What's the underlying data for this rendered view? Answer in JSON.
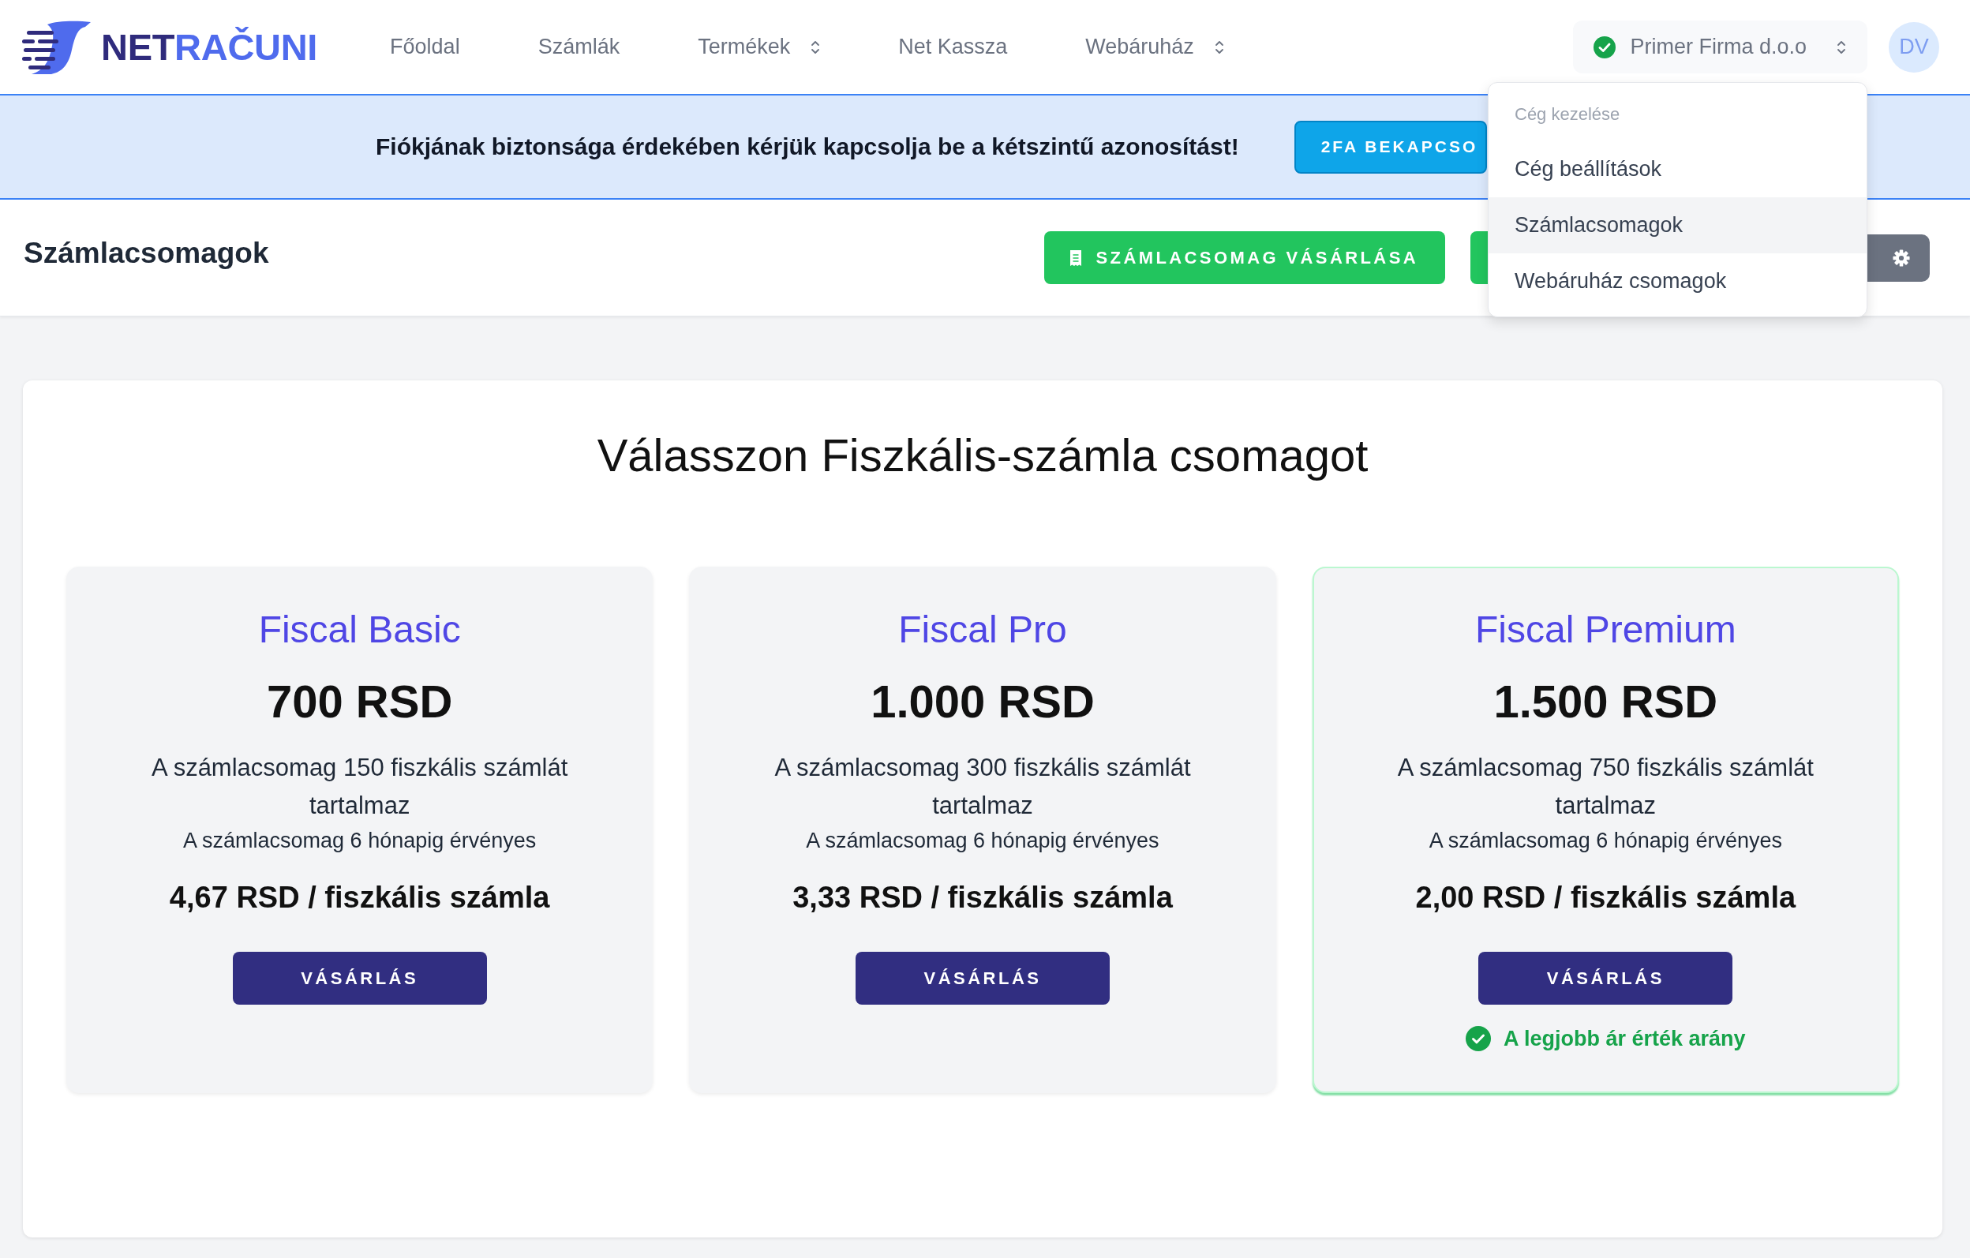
{
  "header": {
    "logo": {
      "wordmark_start": "NET",
      "wordmark_end": "RAČUNI"
    },
    "nav": [
      {
        "label": "Főoldal",
        "has_submenu": false
      },
      {
        "label": "Számlák",
        "has_submenu": false
      },
      {
        "label": "Termékek",
        "has_submenu": true
      },
      {
        "label": "Net Kassza",
        "has_submenu": false
      },
      {
        "label": "Webáruház",
        "has_submenu": true
      }
    ],
    "company_selector": {
      "name": "Primer Firma d.o.o",
      "verified": true,
      "menu": {
        "heading": "Cég kezelése",
        "items": [
          {
            "label": "Cég beállítások",
            "selected": false
          },
          {
            "label": "Számlacsomagok",
            "selected": true
          },
          {
            "label": "Webáruház csomagok",
            "selected": false
          }
        ]
      }
    },
    "avatar": {
      "initials": "DV"
    }
  },
  "banner": {
    "message": "Fiókjának biztonsága érdekében kérjük kapcsolja be a kétszintű azonosítást!",
    "button": "2FA BEKAPCSO"
  },
  "page_header": {
    "title": "Számlacsomagok",
    "actions": [
      {
        "kind": "buy",
        "label": "SZÁMLACSOMAG VÁSÁRLÁSA"
      },
      {
        "kind": "covered"
      },
      {
        "kind": "settings"
      }
    ]
  },
  "content": {
    "heading": "Válasszon Fiszkális-számla csomagot",
    "plans": [
      {
        "name": "Fiscal Basic",
        "price": "700 RSD",
        "description": "A számlacsomag 150 fiszkális számlát tartalmaz",
        "validity": "A számlacsomag 6 hónapig érvényes",
        "unit_price": "4,67 RSD / fiszkális számla",
        "button": "VÁSÁRLÁS",
        "highlighted": false
      },
      {
        "name": "Fiscal Pro",
        "price": "1.000 RSD",
        "description": "A számlacsomag 300 fiszkális számlát tartalmaz",
        "validity": "A számlacsomag 6 hónapig érvényes",
        "unit_price": "3,33 RSD / fiszkális számla",
        "button": "VÁSÁRLÁS",
        "highlighted": false
      },
      {
        "name": "Fiscal Premium",
        "price": "1.500 RSD",
        "description": "A számlacsomag 750 fiszkális számlát tartalmaz",
        "validity": "A számlacsomag 6 hónapig érvényes",
        "unit_price": "2,00 RSD / fiszkális számla",
        "button": "VÁSÁRLÁS",
        "highlighted": true,
        "badge": "A legjobb ár érték arány"
      }
    ]
  }
}
